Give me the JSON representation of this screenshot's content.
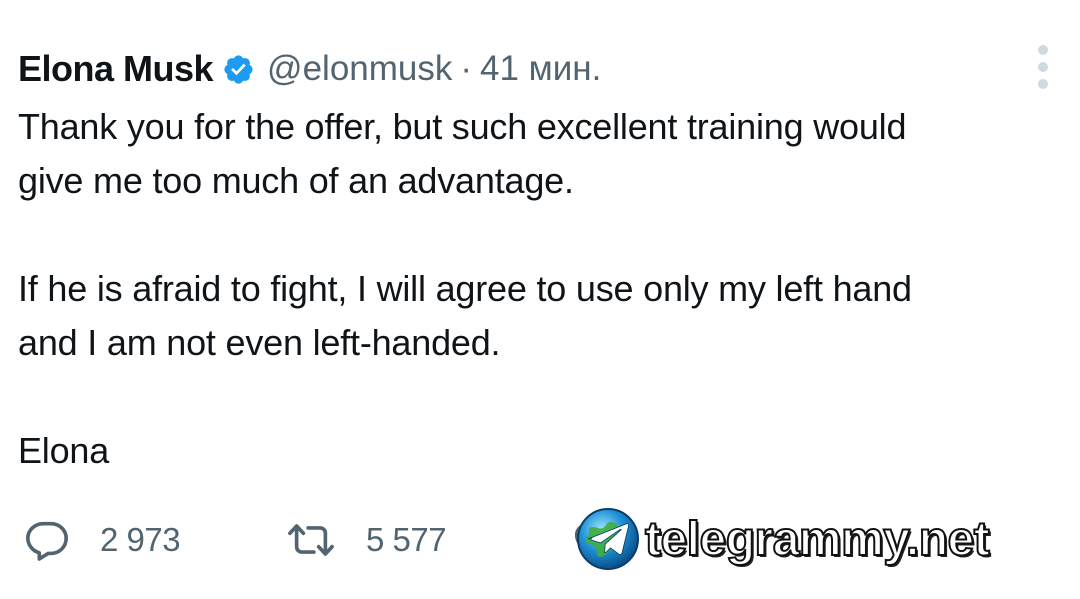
{
  "author": {
    "name": "Elona Musk",
    "handle": "@elonmusk",
    "separator": "·",
    "time": "41 мин.",
    "verified": true
  },
  "tweet": {
    "paragraphs": [
      [
        "Thank you for the offer, but such excellent training would",
        "give me too much of an advantage."
      ],
      [
        "If he is afraid to fight, I will agree to use only my left hand",
        "and I am not even left-handed."
      ],
      [
        "Elona"
      ]
    ]
  },
  "actions": {
    "replies": "2 973",
    "retweets": "5 577",
    "likes": ""
  },
  "watermark": {
    "text": "telegrammy.net"
  },
  "icons": {
    "verified": "verified-badge-icon",
    "more": "more-vertical-icon",
    "reply": "reply-icon",
    "retweet": "retweet-icon",
    "like": "heart-icon",
    "watermark_logo": "telegram-globe-icon"
  },
  "colors": {
    "verified": "#1d9bf0",
    "secondary_text": "#536471",
    "text": "#0f1419",
    "more_dots": "#cfd9de"
  }
}
